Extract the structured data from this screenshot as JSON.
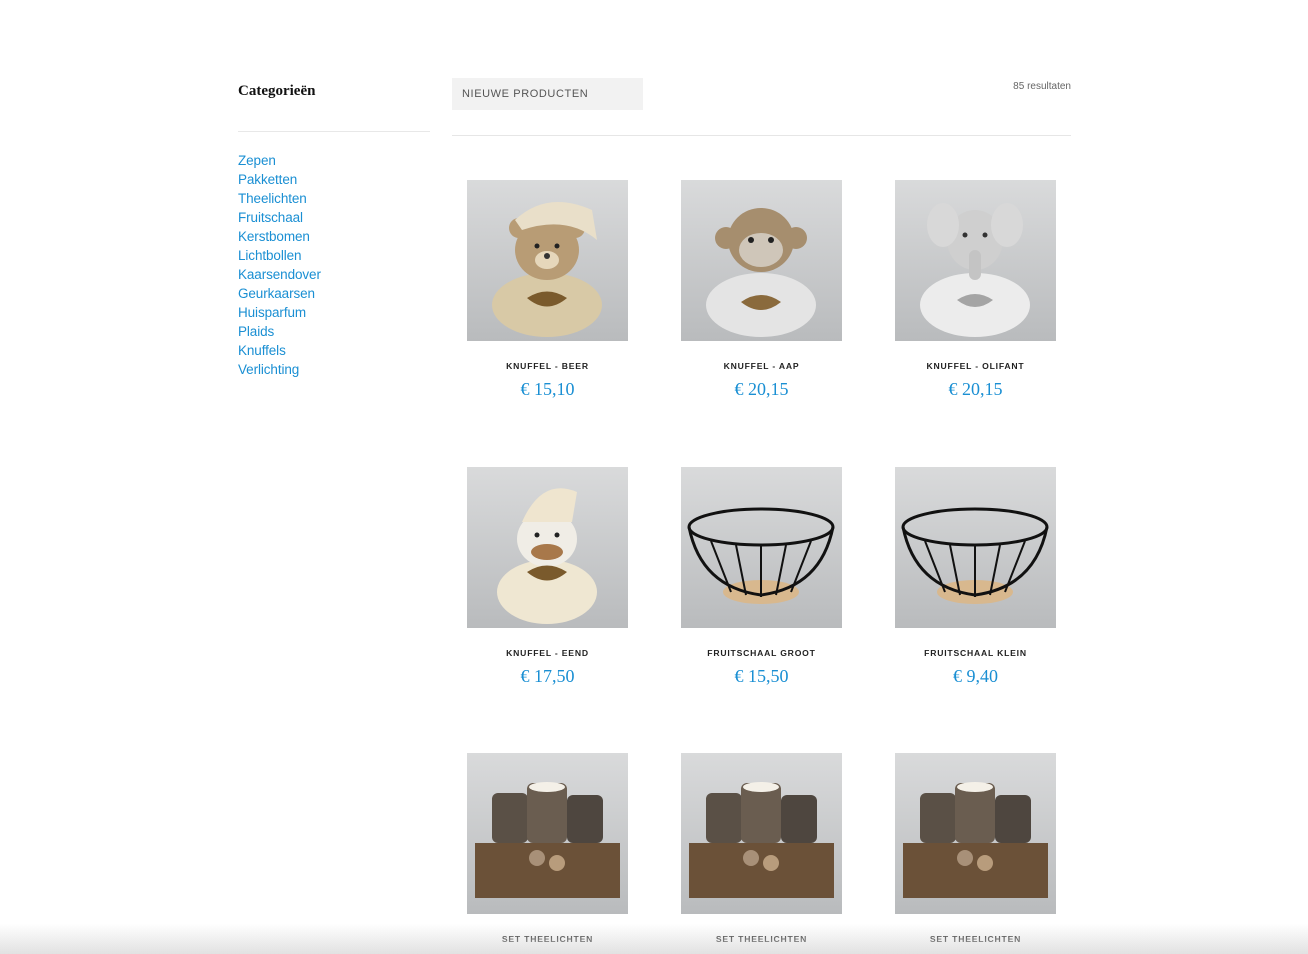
{
  "sidebar": {
    "title": "Categorieën",
    "categories": [
      "Zepen",
      "Pakketten",
      "Theelichten",
      "Fruitschaal",
      "Kerstbomen",
      "Lichtbollen",
      "Kaarsendover",
      "Geurkaarsen",
      "Huisparfum",
      "Plaids",
      "Knuffels",
      "Verlichting"
    ]
  },
  "toolbar": {
    "sort_value": "NIEUWE PRODUCTEN",
    "result_count": "85 resultaten"
  },
  "products": [
    {
      "name": "KNUFFEL - BEER",
      "price": "€ 15,10",
      "image": "bear-plush-image"
    },
    {
      "name": "KNUFFEL - AAP",
      "price": "€ 20,15",
      "image": "monkey-plush-image"
    },
    {
      "name": "KNUFFEL - OLIFANT",
      "price": "€ 20,15",
      "image": "elephant-plush-image"
    },
    {
      "name": "KNUFFEL - EEND",
      "price": "€ 17,50",
      "image": "duck-plush-image"
    },
    {
      "name": "FRUITSCHAAL GROOT",
      "price": "€ 15,50",
      "image": "fruit-bowl-image"
    },
    {
      "name": "FRUITSCHAAL KLEIN",
      "price": "€ 9,40",
      "image": "fruit-bowl-image"
    },
    {
      "name": "SET THEELICHTEN",
      "price": "",
      "image": "tealight-set-image"
    },
    {
      "name": "SET THEELICHTEN",
      "price": "",
      "image": "tealight-set-image"
    },
    {
      "name": "SET THEELICHTEN",
      "price": "",
      "image": "tealight-set-image"
    }
  ],
  "colors": {
    "link": "#1a8fd3",
    "price": "#1a8fd3"
  }
}
